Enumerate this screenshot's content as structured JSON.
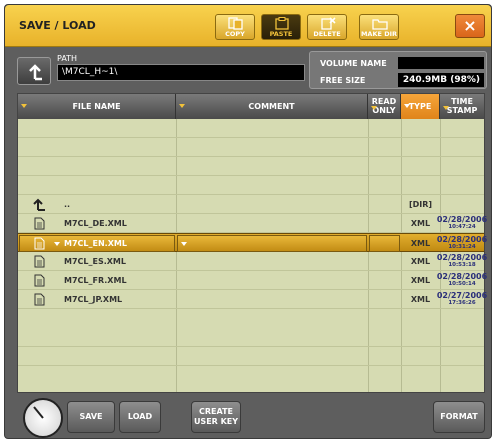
{
  "title": "SAVE / LOAD",
  "toolbar": {
    "copy": "COPY",
    "paste": "PASTE",
    "delete": "DELETE",
    "make_dir": "MAKE DIR",
    "close": "×"
  },
  "path": {
    "label": "PATH",
    "value": "\\M7CL_H~1\\"
  },
  "volume": {
    "name_label": "VOLUME NAME",
    "name_value": "",
    "free_label": "FREE SIZE",
    "free_value": "240.9MB (98%)"
  },
  "columns": {
    "file_name": "FILE NAME",
    "comment": "COMMENT",
    "read_only": [
      "READ",
      "ONLY"
    ],
    "type": "TYPE",
    "time_stamp": [
      "TIME",
      "STAMP"
    ]
  },
  "parent_row": {
    "name": "..",
    "type": "[DIR]"
  },
  "files": [
    {
      "name": "M7CL_DE.XML",
      "type": "XML",
      "date": "02/28/2006",
      "time": "10:47:24",
      "selected": false
    },
    {
      "name": "M7CL_EN.XML",
      "type": "XML",
      "date": "02/28/2006",
      "time": "10:31:24",
      "selected": true
    },
    {
      "name": "M7CL_ES.XML",
      "type": "XML",
      "date": "02/28/2006",
      "time": "10:53:18",
      "selected": false
    },
    {
      "name": "M7CL_FR.XML",
      "type": "XML",
      "date": "02/28/2006",
      "time": "10:50:14",
      "selected": false
    },
    {
      "name": "M7CL_JP.XML",
      "type": "XML",
      "date": "02/27/2006",
      "time": "17:36:26",
      "selected": false
    }
  ],
  "buttons": {
    "save": "SAVE",
    "load": "LOAD",
    "create_user_key": [
      "CREATE",
      "USER KEY"
    ],
    "format": "FORMAT"
  },
  "colors": {
    "titlebar": "#f0c23c",
    "table_bg": "#d6dbb2",
    "type_header": "#f09a30",
    "timestamp": "#2a2f7a"
  }
}
